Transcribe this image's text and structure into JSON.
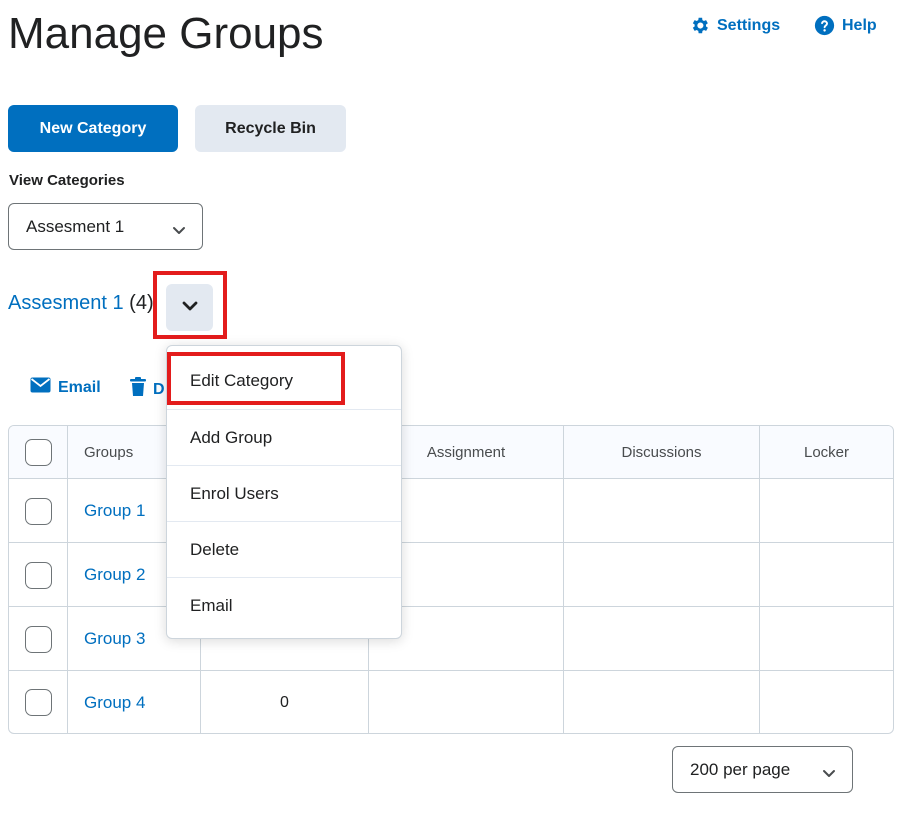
{
  "page": {
    "title": "Manage Groups"
  },
  "header": {
    "settings_label": "Settings",
    "help_label": "Help"
  },
  "toolbar": {
    "new_category_label": "New Category",
    "recycle_bin_label": "Recycle Bin"
  },
  "view_categories": {
    "label": "View Categories",
    "selected": "Assesment 1"
  },
  "category": {
    "name": "Assesment 1",
    "count": "(4)"
  },
  "actions": {
    "email_label": "Email",
    "delete_label_partial": "D"
  },
  "table": {
    "columns": [
      "Groups",
      "",
      "Assignment",
      "Discussions",
      "Locker"
    ],
    "rows": [
      {
        "name": "Group 1",
        "members": ""
      },
      {
        "name": "Group 2",
        "members": ""
      },
      {
        "name": "Group 3",
        "members": ""
      },
      {
        "name": "Group 4",
        "members": "0"
      }
    ]
  },
  "dropdown_menu": {
    "items": [
      "Edit Category",
      "Add Group",
      "Enrol Users",
      "Delete",
      "Email"
    ]
  },
  "pagination": {
    "per_page": "200 per page"
  },
  "colors": {
    "accent": "#006fbf",
    "highlight": "#e31c1c",
    "secondary_bg": "#e3e9f1"
  },
  "icons": [
    "gear-icon",
    "help-icon",
    "chevron-down-icon",
    "envelope-icon",
    "trash-icon"
  ]
}
